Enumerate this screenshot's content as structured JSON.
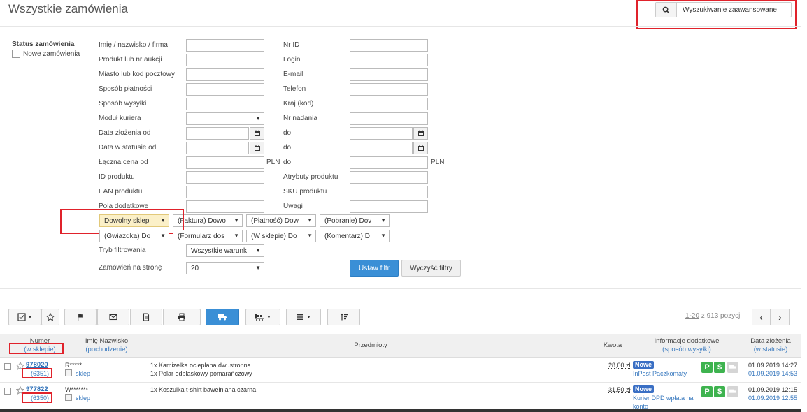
{
  "header": {
    "title": "Wszystkie zamówienia",
    "advanced_search_label": "Wyszukiwanie zaawansowane",
    "advanced_search_icon": "search-icon"
  },
  "status_filter": {
    "title": "Status zamówienia",
    "option": "Nowe zamówienia"
  },
  "filters_left": [
    "Imię / nazwisko / firma",
    "Produkt lub nr aukcji",
    "Miasto lub kod pocztowy",
    "Sposób płatności",
    "Sposób wysyłki",
    "Moduł kuriera",
    "Data złożenia od",
    "Data w statusie od",
    "Łączna cena od",
    "ID produktu",
    "EAN produktu",
    "Pola dodatkowe"
  ],
  "filters_right": [
    "Nr ID",
    "Login",
    "E-mail",
    "Telefon",
    "Kraj (kod)",
    "Nr nadania",
    "do",
    "do",
    "do",
    "Atrybuty produktu",
    "SKU produktu",
    "Uwagi"
  ],
  "currency": "PLN",
  "dropdowns_row1": [
    "Dowolny sklep",
    "(Faktura) Dowo",
    "(Płatność) Dow",
    "(Pobranie) Dov"
  ],
  "dropdowns_row2": [
    "(Gwiazdka) Do",
    "(Formularz dos",
    "(W sklepie) Do",
    "(Komentarz) D"
  ],
  "filter_mode": {
    "label": "Tryb filtrowania",
    "value": "Wszystkie warunk"
  },
  "per_page": {
    "label": "Zamówień na stronę",
    "value": "20"
  },
  "buttons": {
    "apply": "Ustaw filtr",
    "clear": "Wyczyść filtry"
  },
  "pager": {
    "range": "1-20",
    "rest": " z 913 pozycji"
  },
  "table": {
    "headers": {
      "number": "Numer",
      "number_sub": "(w sklepie)",
      "name": "Imię Nazwisko",
      "name_sub": "(pochodzenie)",
      "items": "Przedmioty",
      "amount": "Kwota",
      "info": "Informacje dodatkowe",
      "info_sub": "(sposób wysyłki)",
      "date": "Data złożenia",
      "date_sub": "(w statusie)"
    },
    "rows": [
      {
        "number": "978020",
        "shop_number": "(6351)",
        "name": "R*****",
        "origin": "sklep",
        "items": [
          "1x Kamizelka ocieplana dwustronna",
          "1x Polar odblaskowy pomarańczowy"
        ],
        "amount": "28,00 zł",
        "status": "Nowe",
        "shipping": "InPost Paczkomaty",
        "date_created": "01.09.2019 14:27",
        "date_status": "01.09.2019 14:53"
      },
      {
        "number": "977822",
        "shop_number": "(6350)",
        "name": "W*******",
        "origin": "sklep",
        "items": [
          "1x Koszulka t-shirt bawełniana czarna"
        ],
        "amount": "31,50 zł",
        "status": "Nowe",
        "shipping": "Kurier DPD wpłata na konto",
        "date_created": "01.09.2019 12:15",
        "date_status": "01.09.2019 12:55"
      }
    ]
  },
  "colors": {
    "accent": "#3a8fd6",
    "highlight": "#e0222b",
    "badge": "#3a6fc4",
    "green": "#3eb34f"
  }
}
